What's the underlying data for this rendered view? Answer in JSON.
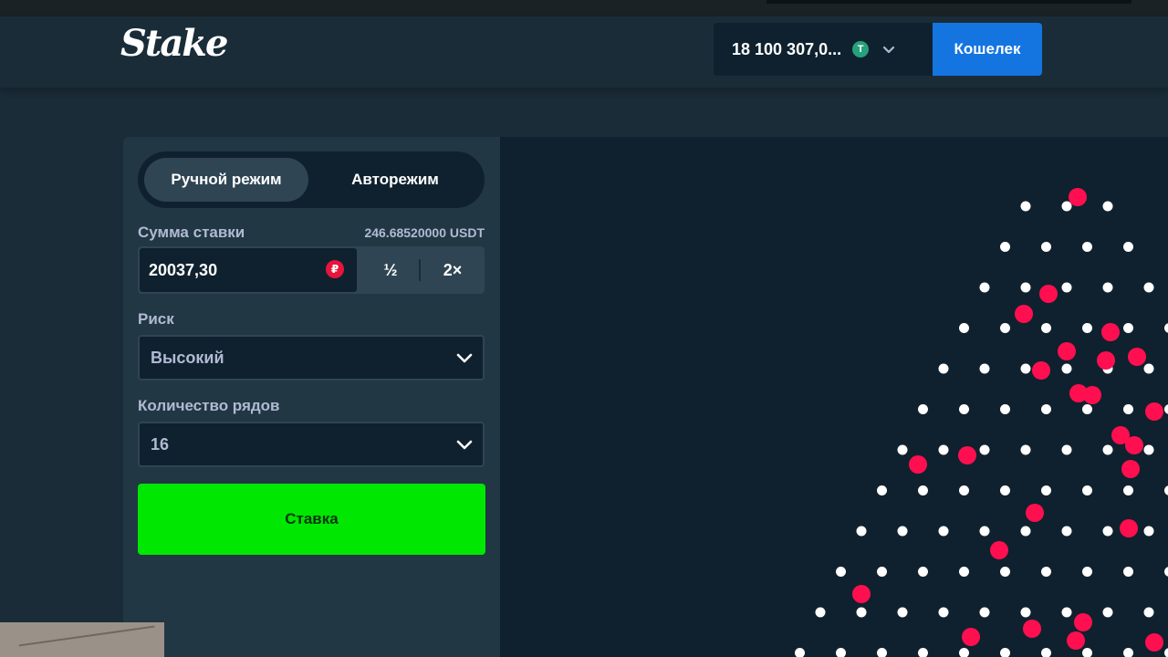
{
  "header": {
    "logo": "Stake",
    "balance": "18 100 307,0...",
    "currency_symbol": "T",
    "wallet_label": "Кошелек"
  },
  "sidebar": {
    "tabs": [
      {
        "label": "Ручной режим",
        "active": true
      },
      {
        "label": "Авторежим",
        "active": false
      }
    ],
    "bet_amount": {
      "label": "Сумма ставки",
      "usdt_value": "246.68520000 USDT",
      "value": "20037,30",
      "currency_symbol": "₽",
      "half_label": "½",
      "double_label": "2×"
    },
    "risk": {
      "label": "Риск",
      "value": "Высокий"
    },
    "rows": {
      "label": "Количество рядов",
      "value": "16"
    },
    "bet_button_label": "Ставка"
  },
  "colors": {
    "accent_green": "#00e701",
    "wallet_blue": "#1475e1",
    "ball_red": "#ff0f4f",
    "peg_white": "#ffffff"
  }
}
